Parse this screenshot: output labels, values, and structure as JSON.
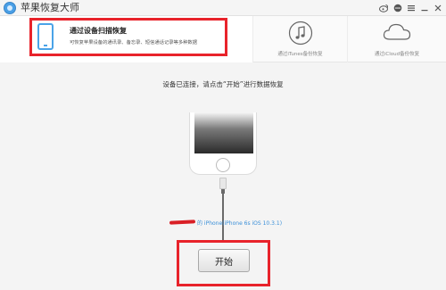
{
  "window": {
    "title": "苹果恢复大师"
  },
  "header": {
    "scan_tab": {
      "title": "通过设备扫描恢复",
      "description": "可恢复苹果设备的通讯录、备忘录、短信通话记录等多种数据",
      "icon": "phone-icon"
    },
    "itunes_tab": {
      "label": "通过iTunes备份恢复",
      "icon": "music-note-icon"
    },
    "icloud_tab": {
      "label": "通过iCloud备份恢复",
      "icon": "cloud-icon"
    }
  },
  "main": {
    "status": "设备已连接，请点击“开始”进行数据恢复",
    "device_info": "的 iPhone(iPhone 6s iOS 10.3.1)",
    "start_label": "开始"
  },
  "colors": {
    "accent": "#3a8fd8",
    "highlight": "#e8232b"
  }
}
